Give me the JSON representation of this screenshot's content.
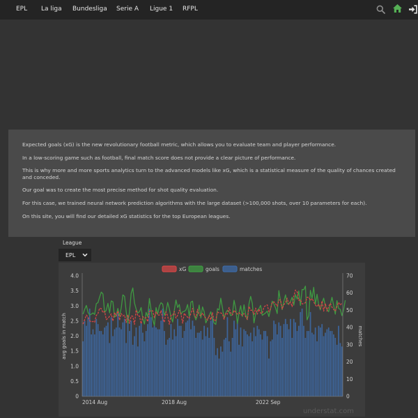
{
  "nav": {
    "items": [
      "EPL",
      "La liga",
      "Bundesliga",
      "Serie A",
      "Ligue 1",
      "RFPL"
    ]
  },
  "icons": {
    "search": "search-icon",
    "home": "home-icon",
    "login": "sign-in-icon",
    "home_color": "#55b055"
  },
  "intro": {
    "paragraphs": [
      "Expected goals (xG) is the new revolutionary football metric, which allows you to evaluate team and player performance.",
      "In a low-scoring game such as football, final match score does not provide a clear picture of performance.",
      "This is why more and more sports analytics turn to the advanced models like xG, which is a statistical measure of the quality of chances created and conceded.",
      "Our goal was to create the most precise method for shot quality evaluation.",
      "For this case, we trained neural network prediction algorithms with the large dataset (>100,000 shots, over 10 parameters for each).",
      "On this site, you will find our detailed xG statistics for the top European leagues."
    ]
  },
  "filter": {
    "label": "League",
    "selected": "EPL"
  },
  "watermark": "understat.com",
  "chart_data": {
    "type": "bar+line",
    "legend": [
      {
        "name": "xG",
        "color": "#d24545"
      },
      {
        "name": "goals",
        "color": "#3f9a42"
      },
      {
        "name": "matches",
        "color": "#3d6aa6"
      }
    ],
    "legend_position": "top-center",
    "ylabel_left": "avg goals in match",
    "ylabel_right": "matches",
    "ylim_left": [
      0,
      4
    ],
    "ylim_right": [
      0,
      70
    ],
    "yticks_left": [
      "0",
      "0.5",
      "1.0",
      "1.5",
      "2.0",
      "2.5",
      "3.0",
      "3.5",
      "4.0"
    ],
    "yticks_right": [
      "0",
      "10",
      "20",
      "30",
      "40",
      "50",
      "60",
      "70"
    ],
    "x_tick_labels": [
      "2014 Aug",
      "2018 Aug",
      "2022 Sep"
    ],
    "x_range": [
      "2014 Aug",
      "2025 Dec"
    ],
    "grid": false,
    "matches_per_period": [
      32,
      44,
      41,
      46,
      51,
      36,
      39,
      36,
      45,
      42,
      38,
      38,
      36,
      40,
      41,
      43,
      31,
      46,
      35,
      39,
      40,
      49,
      40,
      39,
      43,
      45,
      31,
      46,
      38,
      44,
      30,
      35,
      40,
      29,
      41,
      43,
      37,
      32,
      38,
      42,
      51,
      46,
      40,
      41,
      40,
      39,
      39,
      44,
      51,
      38,
      30,
      33,
      34,
      42,
      33,
      39,
      35,
      45,
      41,
      41,
      34,
      38,
      43,
      44,
      46,
      39,
      44,
      41,
      34,
      37,
      37,
      38,
      33,
      41,
      35,
      40,
      34,
      44,
      46,
      34,
      24,
      28,
      22,
      29,
      26,
      33,
      34,
      46,
      32,
      26,
      34,
      44,
      39,
      43,
      30,
      40,
      29,
      39,
      38,
      36,
      35,
      37,
      32,
      40,
      35,
      41,
      39,
      36,
      33,
      38,
      38,
      35,
      22,
      32,
      33,
      44,
      42,
      36,
      43,
      41,
      34,
      42,
      45,
      42,
      39,
      45,
      34,
      45,
      43,
      38,
      41,
      49,
      51,
      41,
      34,
      38,
      38,
      49,
      37,
      36,
      40,
      32,
      41,
      40,
      42,
      35,
      37,
      39,
      40,
      38,
      38,
      36,
      34,
      30,
      41,
      31,
      29
    ],
    "xg_avg": [
      2.4,
      2.55,
      2.7,
      2.63,
      2.51,
      2.47,
      2.49,
      2.46,
      2.69,
      2.75,
      2.93,
      2.91,
      2.78,
      2.82,
      2.55,
      2.59,
      2.66,
      2.74,
      2.5,
      2.79,
      2.66,
      2.84,
      2.53,
      2.75,
      2.67,
      2.7,
      2.45,
      2.71,
      2.42,
      2.67,
      2.66,
      2.39,
      2.87,
      2.67,
      2.67,
      2.41,
      2.65,
      2.6,
      2.61,
      2.48,
      2.82,
      2.85,
      2.84,
      2.61,
      2.82,
      2.7,
      2.7,
      2.85,
      2.58,
      2.46,
      2.81,
      2.67,
      2.39,
      2.69,
      2.69,
      2.82,
      2.6,
      2.69,
      2.86,
      2.74,
      2.43,
      2.76,
      2.68,
      2.63,
      2.59,
      2.76,
      2.92,
      2.71,
      2.62,
      2.89,
      2.71,
      2.67,
      2.77,
      2.66,
      2.6,
      2.53,
      2.69,
      2.54,
      2.78,
      2.5,
      2.53,
      2.8,
      2.77,
      2.77,
      2.74,
      2.56,
      2.77,
      2.73,
      2.95,
      2.77,
      2.7,
      2.86,
      2.79,
      2.73,
      2.78,
      2.72,
      2.69,
      2.75,
      2.64,
      2.55,
      2.99,
      2.86,
      2.86,
      2.72,
      2.93,
      2.73,
      2.9,
      2.76,
      2.76,
      2.97,
      3.01,
      3.04,
      2.81,
      2.91,
      3.12,
      3.14,
      3.08,
      2.99,
      3.19,
      3.21,
      2.9,
      3.04,
      3.11,
      3.26,
      3.05,
      3.13,
      2.98,
      3.32,
      3.53,
      3.47,
      3.18,
      3.22,
      3.07,
      3.08,
      3.11,
      3.29,
      3.29,
      3.18,
      3.25,
      3.14,
      3.03,
      2.98,
      3.06,
      2.91,
      3.17,
      2.83,
      3.09,
      2.83,
      2.99,
      3.09,
      2.96,
      2.89,
      2.83,
      2.98,
      3.12,
      3.03,
      3.1
    ],
    "goals_avg": [
      2.73,
      2.89,
      3.02,
      2.79,
      2.7,
      2.73,
      2.77,
      2.72,
      3.08,
      3.11,
      3.3,
      3.46,
      3.4,
      2.79,
      2.86,
      3.09,
      2.77,
      3.17,
      3.14,
      2.63,
      2.7,
      2.92,
      2.66,
      2.93,
      3.37,
      3.32,
      2.82,
      2.43,
      2.81,
      3.42,
      3.6,
      3.1,
      2.9,
      2.77,
      2.81,
      2.95,
      2.59,
      2.4,
      2.79,
      2.64,
      3.25,
      2.88,
      2.55,
      2.35,
      2.95,
      2.73,
      3.0,
      3.11,
      3.06,
      2.69,
      2.82,
      3.12,
      2.91,
      2.64,
      2.47,
      2.86,
      3.2,
      2.95,
      3.05,
      2.72,
      2.81,
      2.82,
      2.87,
      3.05,
      2.65,
      3.13,
      3.16,
      2.69,
      2.54,
      2.71,
      3.03,
      2.6,
      2.97,
      2.81,
      2.44,
      2.56,
      2.68,
      2.81,
      2.58,
      2.43,
      2.39,
      2.91,
      2.87,
      3.26,
      2.94,
      2.59,
      2.77,
      2.86,
      2.81,
      2.68,
      2.72,
      3.19,
      2.92,
      2.42,
      2.77,
      3.01,
      2.65,
      3.04,
      2.72,
      2.55,
      3.07,
      3.32,
      3.09,
      2.44,
      2.74,
      2.85,
      2.91,
      3.02,
      2.69,
      2.73,
      2.77,
      2.83,
      2.65,
      2.91,
      3.16,
      3.07,
      2.94,
      2.75,
      3.51,
      3.16,
      2.88,
      3.15,
      3.37,
      3.07,
      3.08,
      3.15,
      3.29,
      3.03,
      3.38,
      3.23,
      3.5,
      3.02,
      3.55,
      3.54,
      3.66,
      2.54,
      2.68,
      3.52,
      3.25,
      3.62,
      3.06,
      3.39,
      3.03,
      2.87,
      3.09,
      3.26,
      3.0,
      2.89,
      2.81,
      3.05,
      3.29,
      3.03,
      2.73,
      3.18,
      2.92,
      2.89,
      2.68,
      2.87,
      3.19
    ]
  }
}
